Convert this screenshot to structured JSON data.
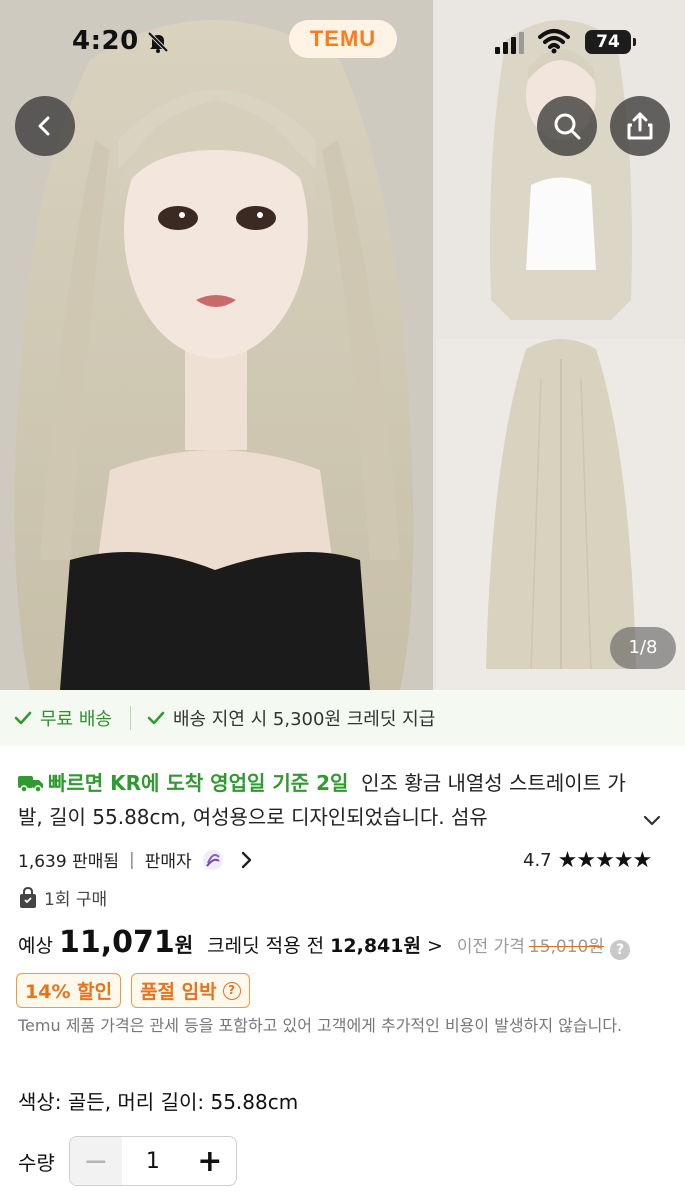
{
  "status_bar": {
    "time": "4:20",
    "brand": "TEMU",
    "battery": "74"
  },
  "gallery": {
    "page_indicator": "1/8"
  },
  "shipping": {
    "free_shipping": "무료 배송",
    "delay_credit": "배송 지연 시 5,300원 크레딧 지급"
  },
  "product": {
    "delivery_promo": "빠르면 KR에 도착 영업일 기준 2일",
    "title": "인조 황금 내열성 스트레이트 가발, 길이 55.88cm, 여성용으로 디자인되었습니다. 섬유",
    "sold": "1,639 판매됨",
    "divider": "|",
    "seller": "판매자",
    "rating": "4.7",
    "stars": "★★★★★",
    "bought": "1회 구매"
  },
  "price": {
    "prefix": "예상",
    "amount": "11,071",
    "unit": "원",
    "credit_label": "크레딧 적용 전",
    "credit_price": "12,841원",
    "chevron": ">",
    "prev_label": "이전 가격",
    "prev_price": "15,010원"
  },
  "badges": {
    "discount": "14% 할인",
    "soldout": "품절 임박"
  },
  "notice": "Temu 제품 가격은 관세 등을 포함하고 있어 고객에게 추가적인 비용이 발생하지 않습니다.",
  "option": {
    "text": "색상: 골든, 머리 길이: 55.88cm"
  },
  "quantity": {
    "label": "수량",
    "value": "1",
    "minus": "−",
    "plus": "+"
  },
  "colors": {
    "accent_orange": "#ff7a1a",
    "green": "#2f9a2f",
    "badge_orange": "#e8731b"
  }
}
